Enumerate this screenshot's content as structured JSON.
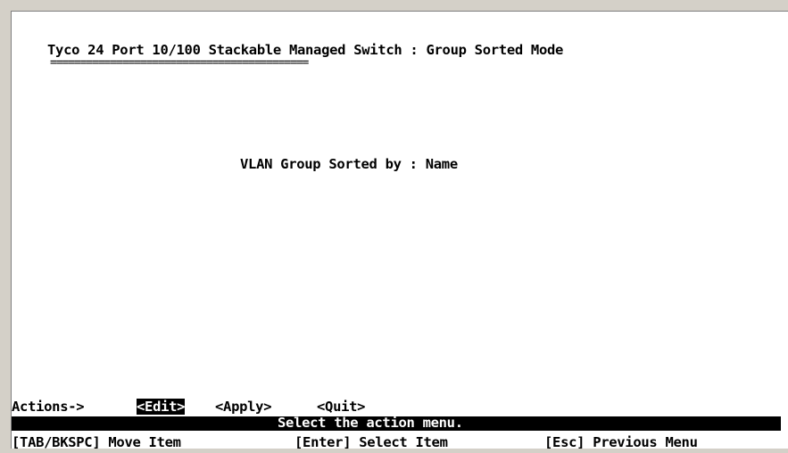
{
  "screen": {
    "title": "Tyco 24 Port 10/100 Stackable Managed Switch : Group Sorted Mode",
    "title_underline": "===========================================",
    "field_text": "VLAN Group Sorted by : Name"
  },
  "actions": {
    "label": "Actions->",
    "items": [
      {
        "label": "<Edit>",
        "selected": true
      },
      {
        "label": "<Apply>",
        "selected": false
      },
      {
        "label": "<Quit>",
        "selected": false
      }
    ]
  },
  "status_bar": {
    "message": "Select the action menu."
  },
  "help_bar": {
    "items": [
      "[TAB/BKSPC] Move Item",
      "[Enter] Select Item",
      "[Esc] Previous Menu"
    ]
  },
  "colors": {
    "background": "#ffffff",
    "text": "#000000",
    "highlight_bg": "#000000",
    "highlight_text": "#ffffff",
    "frame": "#d4d0c8"
  }
}
